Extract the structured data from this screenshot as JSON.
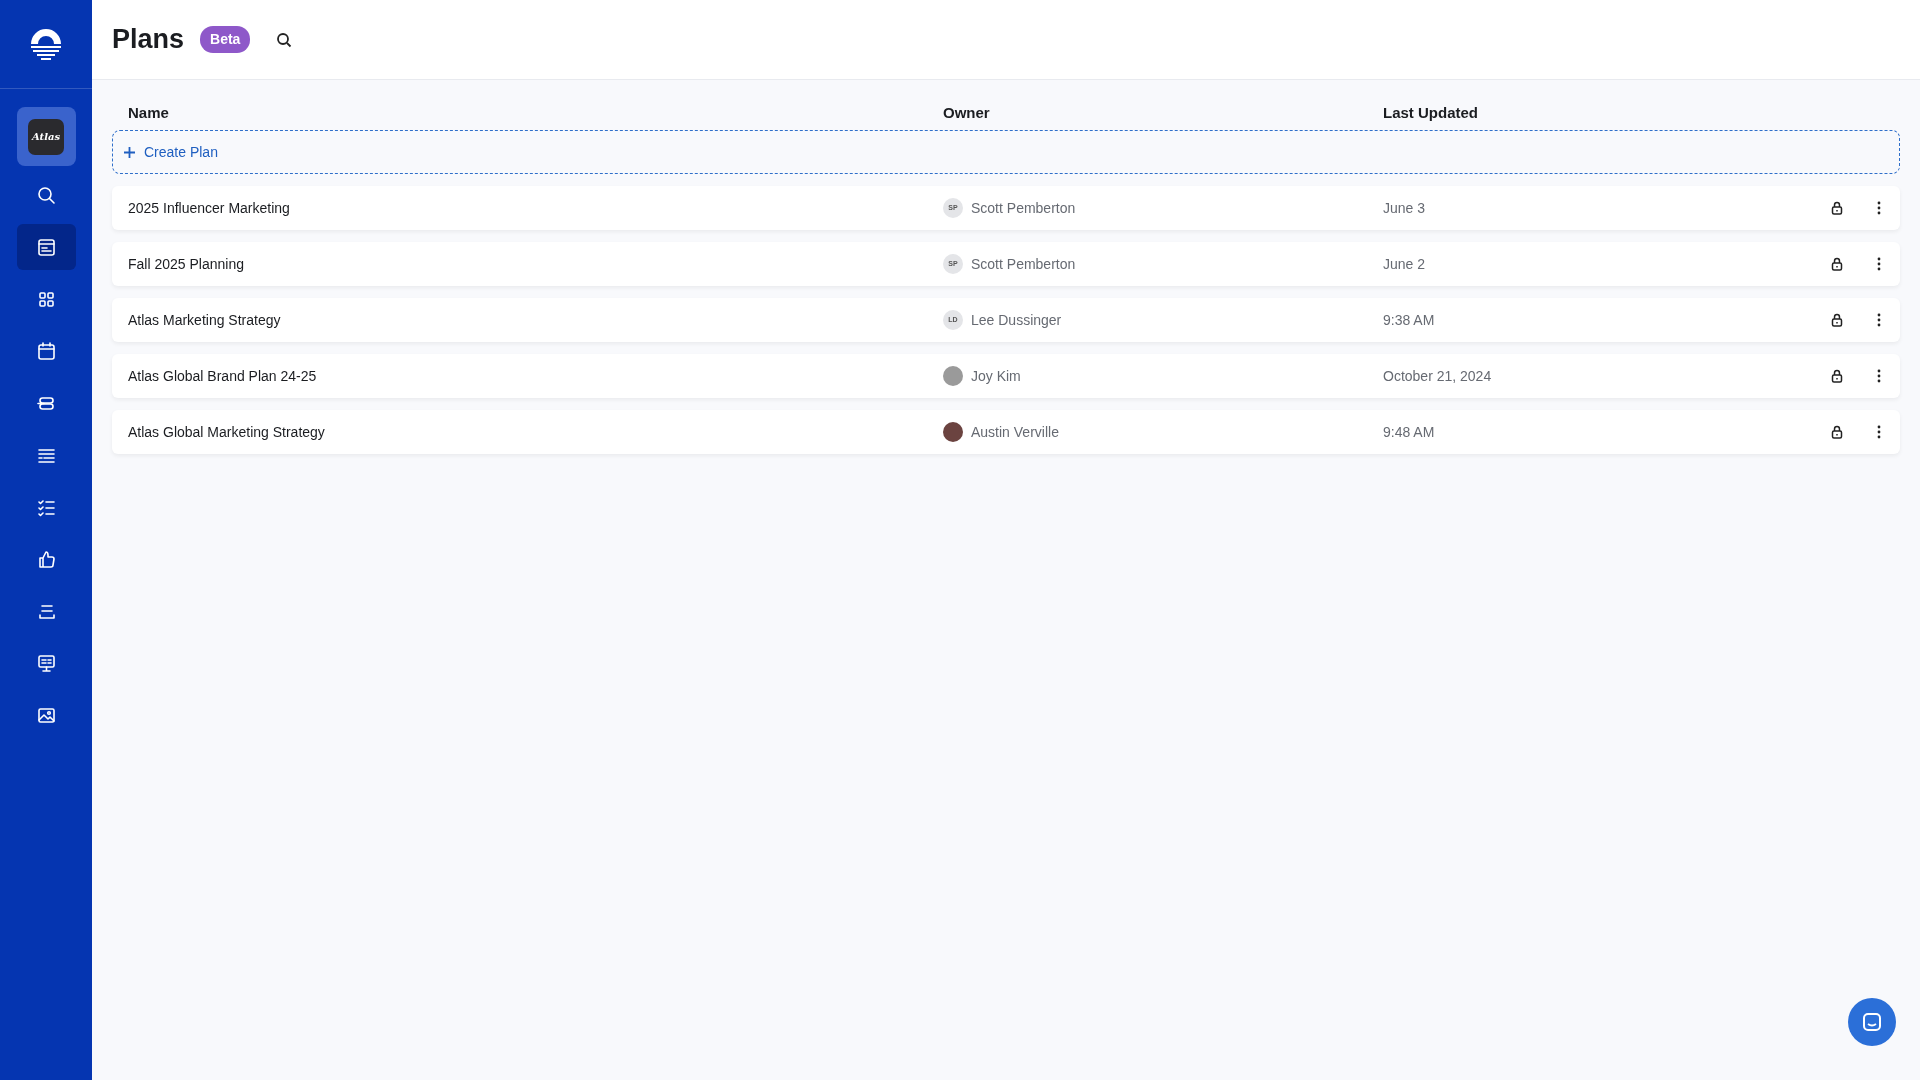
{
  "sidebar": {
    "workspace": {
      "logo_text": "Atlas",
      "selected": true
    },
    "items": [
      {
        "selected": false
      },
      {
        "selected": true
      },
      {
        "selected": false
      },
      {
        "selected": false
      },
      {
        "selected": false
      },
      {
        "selected": false
      },
      {
        "selected": false
      },
      {
        "selected": false
      },
      {
        "selected": false
      },
      {
        "selected": false
      },
      {
        "selected": false
      }
    ]
  },
  "header": {
    "title": "Plans",
    "badge": "Beta"
  },
  "table": {
    "columns": [
      "Name",
      "Owner",
      "Last Updated"
    ],
    "create_label": "Create Plan",
    "rows": [
      {
        "name": "2025 Influencer Marketing",
        "owner": {
          "name": "Scott Pemberton",
          "kind": "initials",
          "initials": "SP"
        },
        "updated": "June 3"
      },
      {
        "name": "Fall 2025 Planning",
        "owner": {
          "name": "Scott Pemberton",
          "kind": "initials",
          "initials": "SP"
        },
        "updated": "June 2"
      },
      {
        "name": "Atlas Marketing Strategy",
        "owner": {
          "name": "Lee Dussinger",
          "kind": "initials",
          "initials": "LD"
        },
        "updated": "9:38 AM"
      },
      {
        "name": "Atlas Global Brand Plan 24-25",
        "owner": {
          "name": "Joy Kim",
          "kind": "photo"
        },
        "updated": "October 21, 2024"
      },
      {
        "name": "Atlas Global Marketing Strategy",
        "owner": {
          "name": "Austin Verville",
          "kind": "photo"
        },
        "updated": "9:48 AM"
      }
    ]
  }
}
